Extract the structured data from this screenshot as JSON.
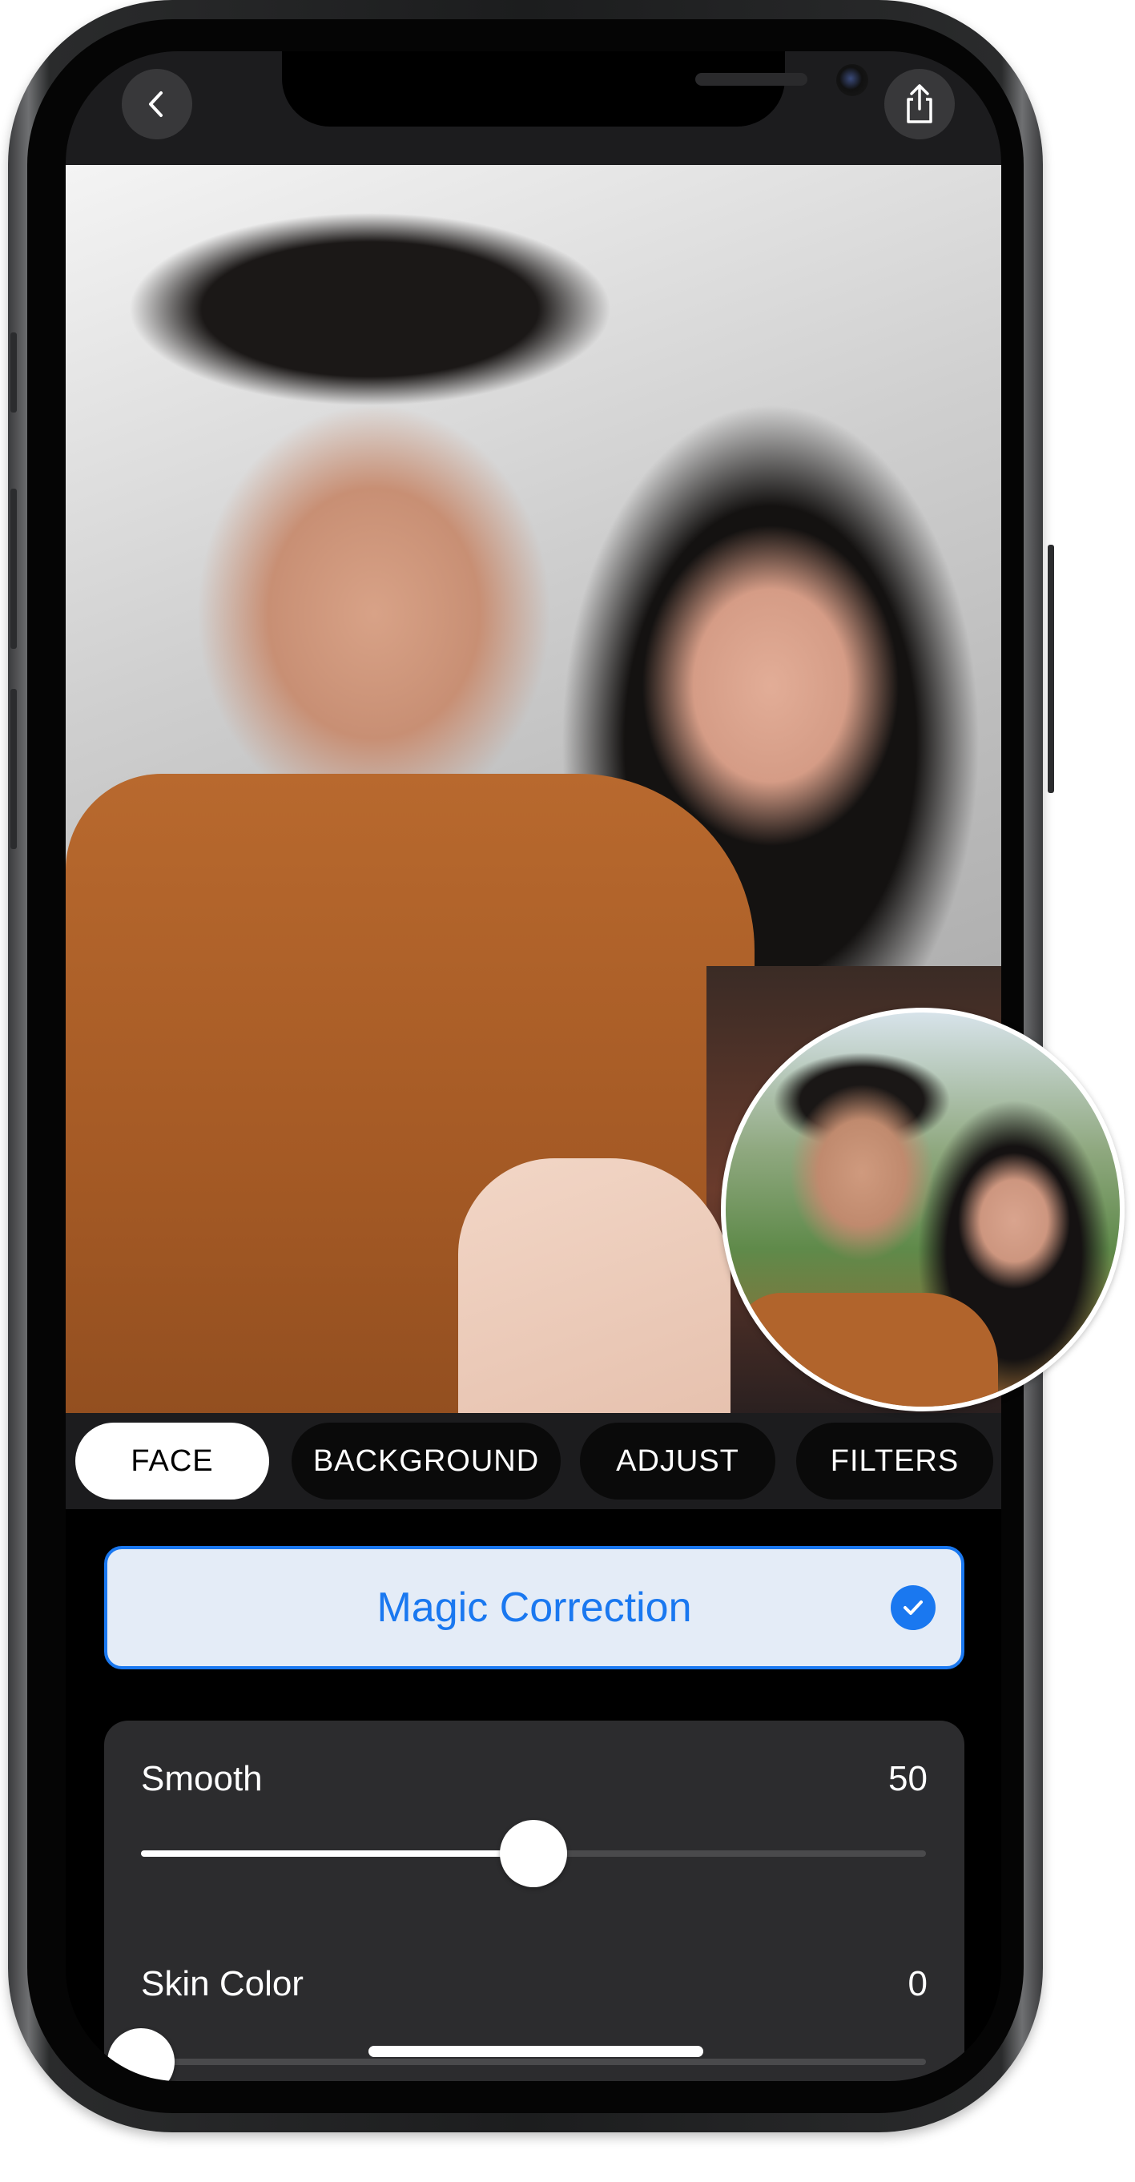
{
  "toolbar": {
    "back_icon": "chevron-left-icon",
    "share_icon": "share-icon"
  },
  "tabs": [
    {
      "label": "FACE",
      "active": true
    },
    {
      "label": "BACKGROUND",
      "active": false
    },
    {
      "label": "ADJUST",
      "active": false
    },
    {
      "label": "FILTERS",
      "active": false
    }
  ],
  "magic_correction": {
    "label": "Magic Correction",
    "checked": true,
    "accent": "#1a78f0"
  },
  "sliders": [
    {
      "label": "Smooth",
      "value": "50",
      "fraction": 0.5
    },
    {
      "label": "Skin Color",
      "value": "0",
      "fraction": 0
    }
  ]
}
